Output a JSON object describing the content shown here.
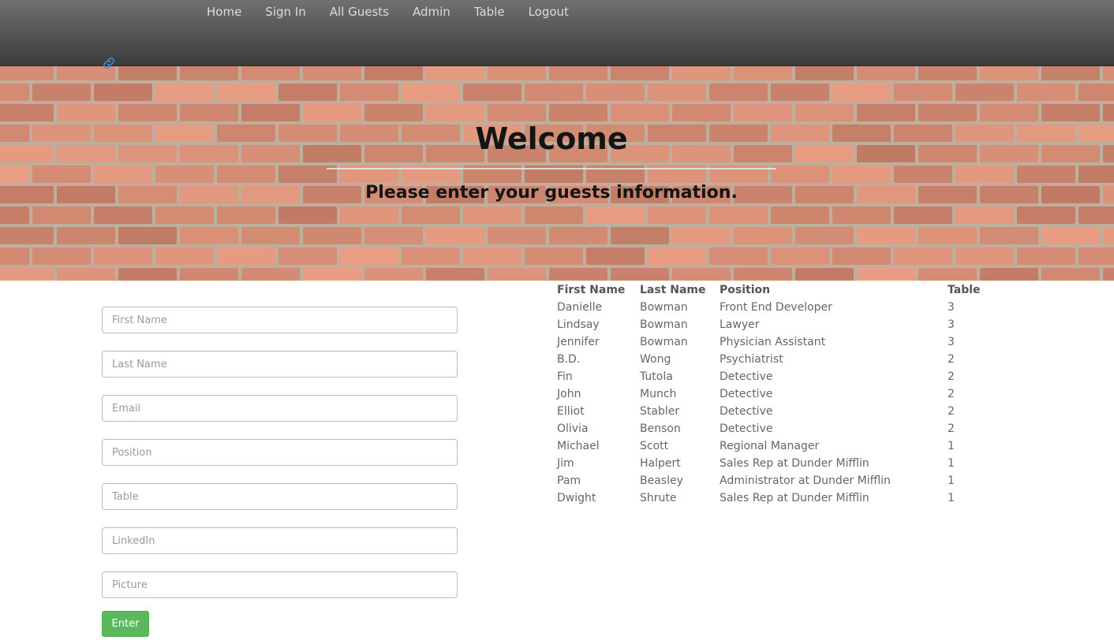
{
  "nav": {
    "items": [
      "Home",
      "Sign In",
      "All Guests",
      "Admin",
      "Table",
      "Logout"
    ],
    "brand_icon": "link-icon",
    "brand_color": "#3a8fd6"
  },
  "hero": {
    "title": "Welcome",
    "subtitle": "Please enter your guests information."
  },
  "form": {
    "placeholders": {
      "first_name": "First Name",
      "last_name": "Last Name",
      "email": "Email",
      "position": "Position",
      "table": "Table",
      "linkedin": "LinkedIn",
      "picture": "Picture"
    },
    "submit_label": "Enter",
    "submit_color": "#5cb85c"
  },
  "guests": {
    "headers": [
      "First Name",
      "Last Name",
      "Position",
      "Table"
    ],
    "rows": [
      [
        "Danielle",
        "Bowman",
        "Front End Developer",
        "3"
      ],
      [
        "Lindsay",
        "Bowman",
        "Lawyer",
        "3"
      ],
      [
        "Jennifer",
        "Bowman",
        "Physician Assistant",
        "3"
      ],
      [
        "B.D.",
        "Wong",
        "Psychiatrist",
        "2"
      ],
      [
        "Fin",
        "Tutola",
        "Detective",
        "2"
      ],
      [
        "John",
        "Munch",
        "Detective",
        "2"
      ],
      [
        "Elliot",
        "Stabler",
        "Detective",
        "2"
      ],
      [
        "Olivia",
        "Benson",
        "Detective",
        "2"
      ],
      [
        "Michael",
        "Scott",
        "Regional Manager",
        "1"
      ],
      [
        "Jim",
        "Halpert",
        "Sales Rep at Dunder Mifflin",
        "1"
      ],
      [
        "Pam",
        "Beasley",
        "Administrator at Dunder Mifflin",
        "1"
      ],
      [
        "Dwight",
        "Shrute",
        "Sales Rep at Dunder Mifflin",
        "1"
      ]
    ]
  }
}
